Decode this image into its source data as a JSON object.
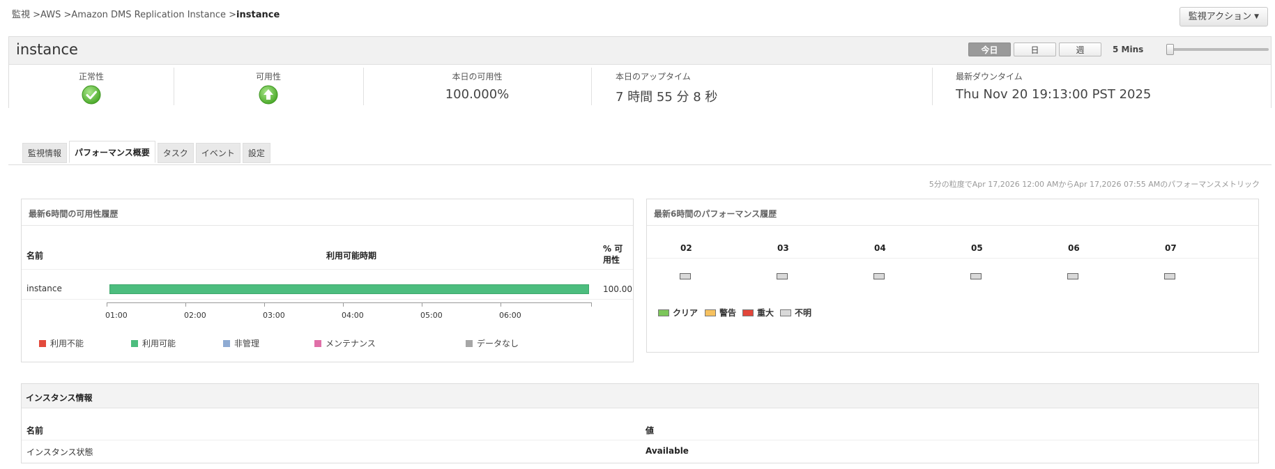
{
  "breadcrumb": {
    "items": [
      "監視 >",
      "AWS >",
      "Amazon DMS Replication Instance >"
    ],
    "current": "instance"
  },
  "actions": {
    "monitor_action_label": "監視アクション"
  },
  "header": {
    "title": "instance",
    "periods": [
      {
        "label": "今日",
        "active": true
      },
      {
        "label": "日",
        "active": false
      },
      {
        "label": "週",
        "active": false
      }
    ],
    "interval": "5 Mins",
    "metrics": {
      "health": {
        "label": "正常性",
        "icon": "check-circle-icon"
      },
      "availability": {
        "label": "可用性",
        "icon": "arrow-up-circle-icon"
      },
      "today_availability": {
        "label": "本日の可用性",
        "value": "100.000%"
      },
      "today_uptime": {
        "label": "本日のアップタイム",
        "value": "7 時間 55 分 8 秒"
      },
      "last_downtime": {
        "label": "最新ダウンタイム",
        "value": "Thu Nov 20 19:13:00 PST 2025"
      }
    }
  },
  "tabs": [
    {
      "label": "監視情報",
      "active": false
    },
    {
      "label": "パフォーマンス概要",
      "active": true
    },
    {
      "label": "タスク",
      "active": false
    },
    {
      "label": "イベント",
      "active": false
    },
    {
      "label": "設定",
      "active": false
    }
  ],
  "metric_range_text": "5分の粒度でApr 17,2026 12:00 AMからApr 17,2026 07:55 AMのパフォーマンスメトリック",
  "availability_history": {
    "title": "最新6時間の可用性履歴",
    "col_name": "名前",
    "col_period": "利用可能時期",
    "col_percent": "% 可用性",
    "row": {
      "name": "instance",
      "percent": "100.00",
      "available_fraction": 1.0,
      "color": "#4cbd7e"
    },
    "ticks": [
      "01:00",
      "02:00",
      "03:00",
      "04:00",
      "05:00",
      "06:00"
    ],
    "legend": [
      {
        "label": "利用不能",
        "color": "#e34a3c"
      },
      {
        "label": "利用可能",
        "color": "#4cbd7e"
      },
      {
        "label": "非管理",
        "color": "#8fabd3"
      },
      {
        "label": "メンテナンス",
        "color": "#e070a8"
      },
      {
        "label": "データなし",
        "color": "#a6a6a6"
      }
    ]
  },
  "performance_history": {
    "title": "最新6時間のパフォーマンス履歴",
    "hours": [
      "02",
      "03",
      "04",
      "05",
      "06",
      "07"
    ],
    "legend": [
      {
        "label": "クリア",
        "color": "#7cc65a"
      },
      {
        "label": "警告",
        "color": "#f6c15f"
      },
      {
        "label": "重大",
        "color": "#e2463a"
      },
      {
        "label": "不明",
        "color": "#d9d9d9"
      }
    ]
  },
  "instance_info": {
    "title": "インスタンス情報",
    "col_name": "名前",
    "col_value": "値",
    "rows": [
      {
        "name": "インスタンス状態",
        "value": "Available"
      }
    ]
  }
}
